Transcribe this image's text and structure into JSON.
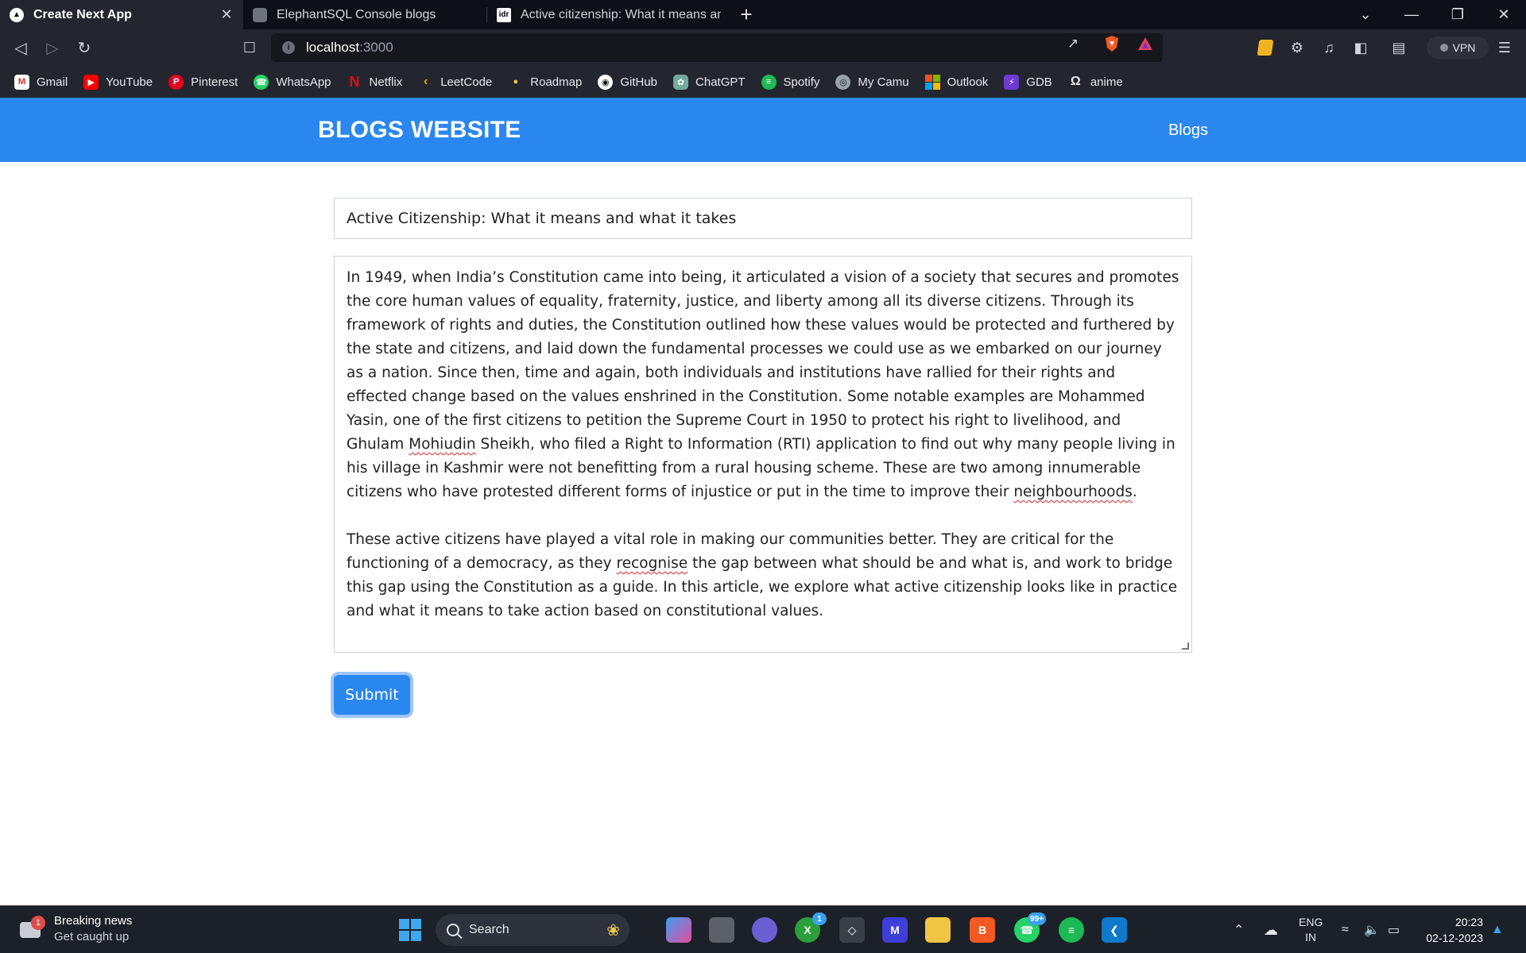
{
  "browser": {
    "tabs": [
      {
        "title": "Create Next App",
        "active": true
      },
      {
        "title": "ElephantSQL Console blogs",
        "active": false
      },
      {
        "title": "Active citizenship: What it means and wh",
        "active": false
      }
    ],
    "address": {
      "host": "localhost",
      "port": ":3000"
    },
    "vpn_label": "VPN",
    "bookmarks": [
      "Gmail",
      "YouTube",
      "Pinterest",
      "WhatsApp",
      "Netflix",
      "LeetCode",
      "Roadmap",
      "GitHub",
      "ChatGPT",
      "Spotify",
      "My Camu",
      "Outlook",
      "GDB",
      "anime"
    ]
  },
  "page": {
    "brand": "BLOGS WEBSITE",
    "nav_link": "Blogs",
    "title_value": "Active Citizenship: What it means and what it takes",
    "content": {
      "p1_a": "In 1949, when India’s Constitution came into being, it articulated a vision of a society that secures and promotes the core human values of equality, fraternity, justice, and liberty among all its diverse citizens. Through its framework of rights and duties, the Constitution outlined how these values would be protected and furthered by the state and citizens, and laid down the fundamental processes we could use as we embarked on our journey as a nation. Since then, time and again, both individuals and institutions have rallied for their rights and effected change based on the values enshrined in the Constitution. Some notable examples are Mohammed Yasin, one of the first citizens to petition the Supreme Court in 1950 to protect his right to livelihood, and Ghulam ",
      "p1_b": "Mohiudin",
      "p1_c": " Sheikh, who filed a Right to Information (RTI) application to find out why many people living in his village in Kashmir were not benefitting from a rural housing scheme. These are two among innumerable citizens who have protested different forms of injustice or put in the time to improve their ",
      "p1_d": "neighbourhoods",
      "p1_e": ".",
      "p2_a": "These active citizens have played a vital role in making our communities better. They are critical for the functioning of a democracy, as they ",
      "p2_b": "recognise",
      "p2_c": " the gap between what should be and what is, and work to bridge this gap using the Constitution as a guide. In this article, we explore what active citizenship looks like in practice and what it means to take action based on constitutional values."
    },
    "submit_label": "Submit"
  },
  "taskbar": {
    "news_title": "Breaking news",
    "news_subtitle": "Get caught up",
    "news_badge": "1",
    "search_label": "Search",
    "xbox_badge": "1",
    "whatsapp_badge": "99+",
    "lang_top": "ENG",
    "lang_bottom": "IN",
    "time": "20:23",
    "date": "02-12-2023"
  }
}
